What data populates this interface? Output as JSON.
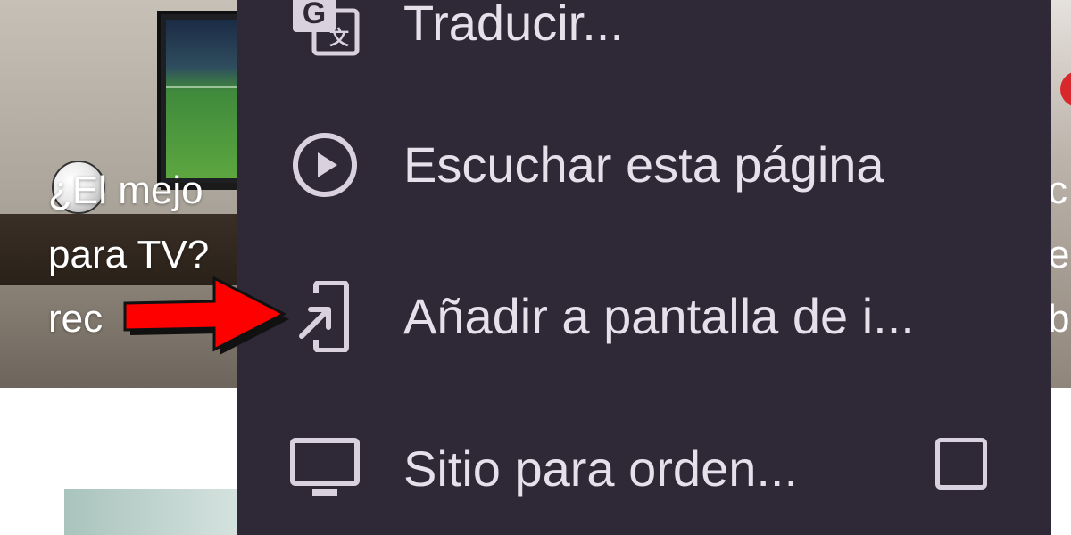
{
  "background_page": {
    "article_title": "¿El mejo\npara TV?\nrec",
    "right_article_fragment": "c\nes\nbl"
  },
  "menu": {
    "items": [
      {
        "label": "Traducir...",
        "icon": "google-translate-icon"
      },
      {
        "label": "Escuchar esta página",
        "icon": "play-circle-icon"
      },
      {
        "label": "Añadir a pantalla de i...",
        "icon": "add-to-home-screen-icon"
      },
      {
        "label": "Sitio para orden...",
        "icon": "desktop-monitor-icon",
        "checked": false
      }
    ]
  },
  "annotation": {
    "arrow_color": "#ff0000",
    "points_to": "Añadir a pantalla de i..."
  },
  "colors": {
    "menu_bg": "#2e2837",
    "menu_text": "#e6e0ea",
    "icon": "#d9d2de"
  }
}
